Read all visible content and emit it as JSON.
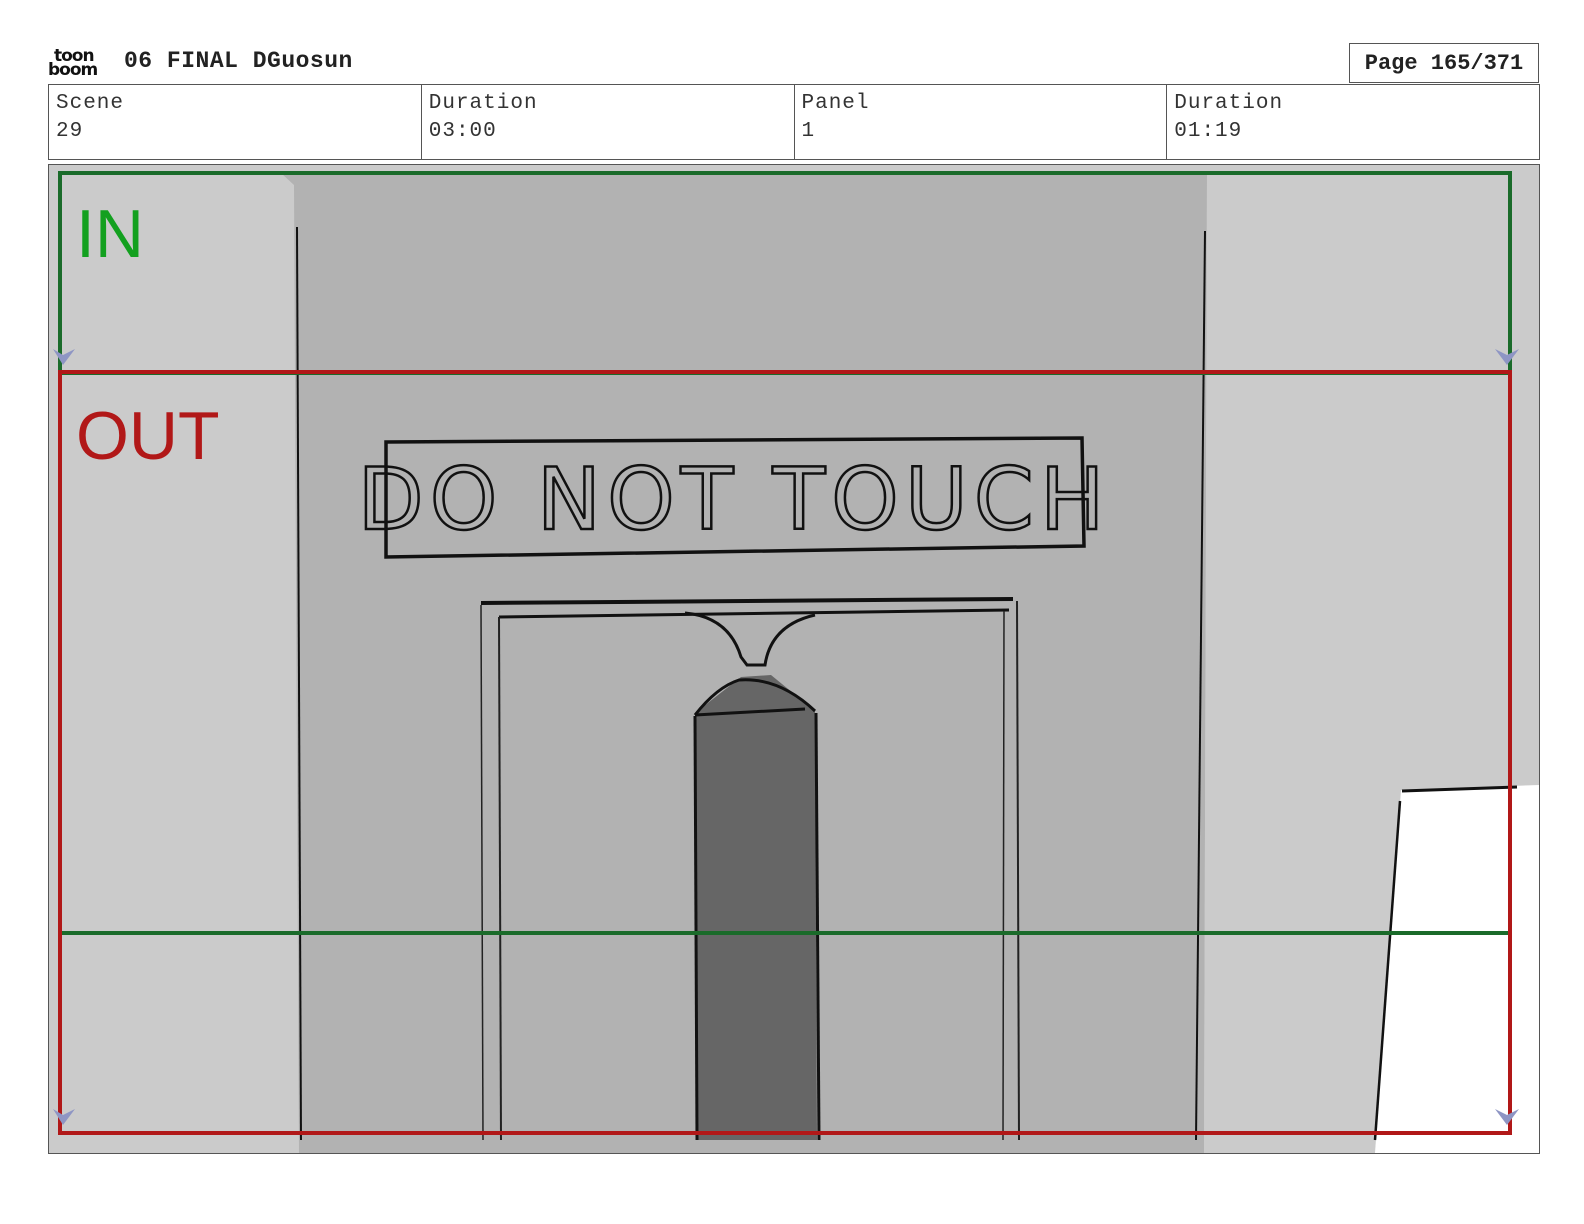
{
  "header": {
    "logo_top": "toon",
    "logo_bottom": "boom",
    "title": "06 FINAL DGuosun",
    "page": "Page 165/371"
  },
  "info": {
    "scene_label": "Scene",
    "scene_value": "29",
    "duration_label": "Duration",
    "duration_value": "03:00",
    "panel_label": "Panel",
    "panel_value": "1",
    "panel_duration_label": "Duration",
    "panel_duration_value": "01:19"
  },
  "panel": {
    "in_label": "IN",
    "out_label": "OUT",
    "sign_text": "DO NOT TOUCH",
    "colors": {
      "in_frame": "#1a6b2a",
      "in_text": "#13a01f",
      "out_frame": "#b11818",
      "out_text": "#b11818",
      "wall_light": "#cbcbcb",
      "wall_mid": "#b2b2b2",
      "pillar": "#666666"
    }
  }
}
